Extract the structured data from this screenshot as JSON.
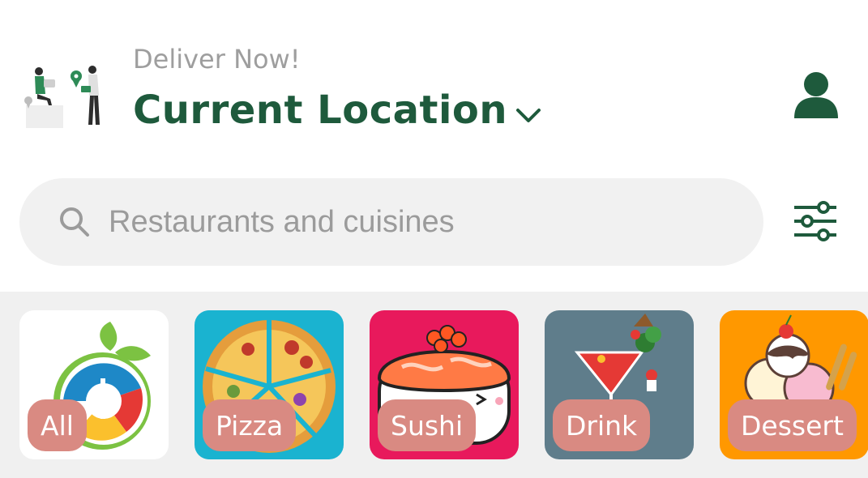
{
  "header": {
    "subtitle": "Deliver Now!",
    "location_label": "Current Location"
  },
  "search": {
    "placeholder": "Restaurants and cuisines"
  },
  "colors": {
    "brand_green": "#1e5a3c",
    "label_bg": "#d98a82",
    "search_bg": "#f1f1f1",
    "category_bar_bg": "#f0f0f0"
  },
  "categories": [
    {
      "label": "All",
      "bg": "#ffffff"
    },
    {
      "label": "Pizza",
      "bg": "#1ab3d0"
    },
    {
      "label": "Sushi",
      "bg": "#e8195c"
    },
    {
      "label": "Drink",
      "bg": "#5f7d8b"
    },
    {
      "label": "Dessert",
      "bg": "#ff9800"
    }
  ]
}
